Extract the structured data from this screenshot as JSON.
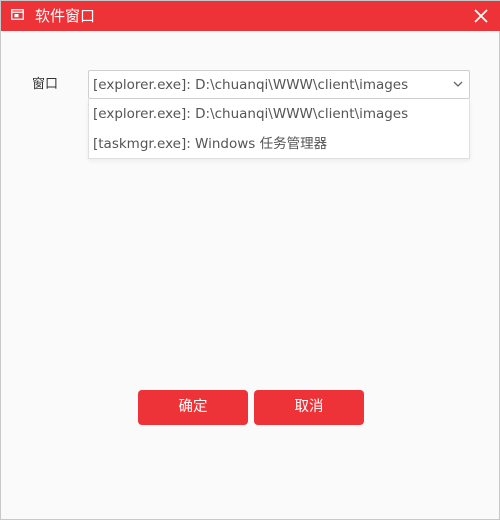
{
  "window": {
    "title": "软件窗口",
    "accent_color": "#ee3338",
    "title_icon": "window-icon",
    "close_icon": "close-icon"
  },
  "form": {
    "window_label": "窗口",
    "selected_value": "[explorer.exe]: D:\\chuanqi\\WWW\\client\\images",
    "dropdown_icon": "chevron-down-icon",
    "options": [
      "[explorer.exe]: D:\\chuanqi\\WWW\\client\\images",
      "[taskmgr.exe]: Windows 任务管理器"
    ]
  },
  "buttons": {
    "ok_label": "确定",
    "cancel_label": "取消"
  }
}
